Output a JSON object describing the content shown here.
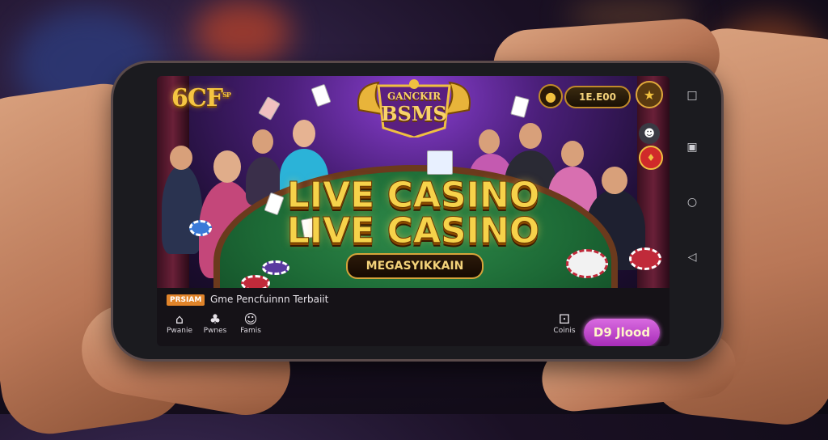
{
  "app": {
    "logo_text": "6CF",
    "logo_sup": "SP",
    "crest_line1": "GANCKIR",
    "crest_line2": "BSMS"
  },
  "header": {
    "balance_label": "1E.E00",
    "wallet_icon": "coin-stack-icon",
    "avatar_icon": "trophy-coin-icon"
  },
  "side_buttons": {
    "chef_icon": "dealer-icon",
    "gift_icon": "gift-icon"
  },
  "hero": {
    "title_line1": "LIVE CASINO",
    "title_line2": "LIVE CASINO",
    "subtitle": "MEGASYIKKAIN"
  },
  "footer": {
    "tag": "PRSIAM",
    "tagline": "Gme Pencfuinnn Terbaiit",
    "nav_items": [
      {
        "label": "Pwanie",
        "icon": "home-icon"
      },
      {
        "label": "Pwnes",
        "icon": "card-icon"
      },
      {
        "label": "Famis",
        "icon": "people-icon"
      }
    ],
    "extra_item": {
      "label": "Coinis",
      "icon": "dice-icon"
    },
    "cta_label": "D9 Jlood"
  },
  "system_nav": {
    "buttons": [
      "square-icon",
      "recent-icon",
      "home-circle-icon",
      "back-triangle-icon"
    ]
  },
  "colors": {
    "accent_gold": "#f6d24a",
    "cta_purple": "#c04ad0",
    "felt_green": "#2f8b4a"
  }
}
